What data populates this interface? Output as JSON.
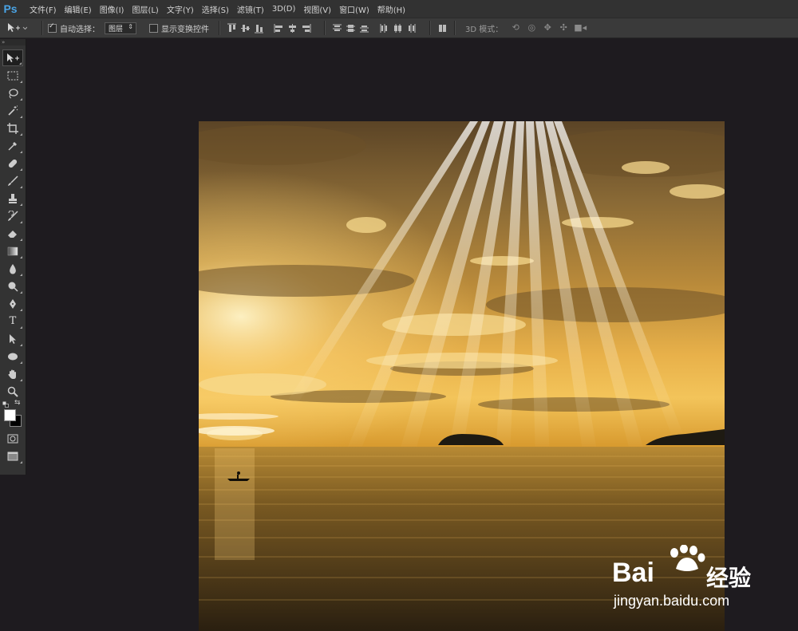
{
  "app": {
    "logo": "Ps"
  },
  "menu": [
    "文件(F)",
    "编辑(E)",
    "图像(I)",
    "图层(L)",
    "文字(Y)",
    "选择(S)",
    "滤镜(T)",
    "3D(D)",
    "视图(V)",
    "窗口(W)",
    "帮助(H)"
  ],
  "options": {
    "auto_select_label": "自动选择：",
    "auto_select_checked": true,
    "auto_select_value": "图层",
    "show_transform_label": "显示变换控件",
    "show_transform_checked": false,
    "mode_3d_label": "3D 模式："
  },
  "tools": [
    "move-tool",
    "marquee-tool",
    "lasso-tool",
    "magic-wand-tool",
    "crop-tool",
    "eyedropper-tool",
    "healing-brush-tool",
    "brush-tool",
    "clone-stamp-tool",
    "history-brush-tool",
    "eraser-tool",
    "gradient-tool",
    "blur-tool",
    "dodge-tool",
    "pen-tool",
    "type-tool",
    "path-selection-tool",
    "ellipse-tool",
    "hand-tool",
    "zoom-tool"
  ],
  "type_tool_glyph": "T",
  "colors": {
    "foreground": "#ffffff",
    "background": "#000000",
    "ps_blue": "#4aa4e6"
  },
  "watermark": {
    "brand_left": "Bai",
    "brand_right": "经验",
    "url": "jingyan.baidu.com"
  }
}
